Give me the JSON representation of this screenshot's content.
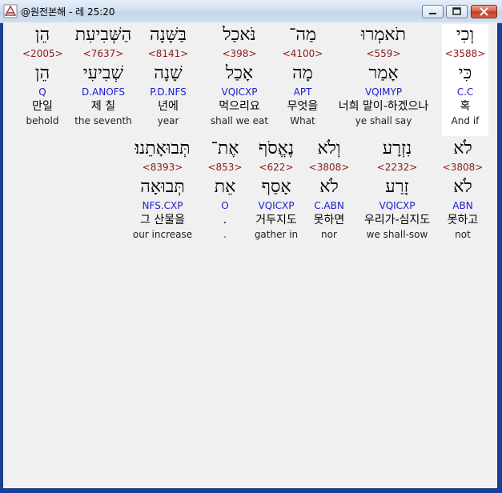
{
  "window": {
    "title": "@원전본해 - 레 25:20"
  },
  "rows": [
    {
      "words": [
        {
          "heb": "וְכִי",
          "strong": "<3588>",
          "lemma": "כִּי",
          "parse": "C.C",
          "kor": "혹",
          "eng": "And if",
          "selected": true
        },
        {
          "heb": "תֹאמְרוּ",
          "strong": "<559>",
          "lemma": "אָמַר",
          "parse": "VQIMYP",
          "kor": "너희 말이-하겠으나",
          "eng": "ye shall say",
          "selected": false
        },
        {
          "heb": "מַה־",
          "strong": "<4100>",
          "lemma": "מָה",
          "parse": "APT",
          "kor": "무엇을",
          "eng": "What",
          "selected": false
        },
        {
          "heb": "נֹּאכַל",
          "strong": "<398>",
          "lemma": "אָכַל",
          "parse": "VQICXP",
          "kor": "먹으리요",
          "eng": "shall we eat",
          "selected": false
        },
        {
          "heb": "בַּשָּׁנָה",
          "strong": "<8141>",
          "lemma": "שָׁנָה",
          "parse": "P.D.NFS",
          "kor": "년에",
          "eng": "year",
          "selected": false
        },
        {
          "heb": "הַשְּׁבִיעִת",
          "strong": "<7637>",
          "lemma": "שְׁבִיעִי",
          "parse": "D.ANOFS",
          "kor": "제 칠",
          "eng": "the seventh",
          "selected": false
        },
        {
          "heb": "הֵן",
          "strong": "<2005>",
          "lemma": "הֵן",
          "parse": "Q",
          "kor": "만일",
          "eng": "behold",
          "selected": false
        }
      ]
    },
    {
      "words": [
        {
          "heb": "לֹא",
          "strong": "<3808>",
          "lemma": "לֹא",
          "parse": "ABN",
          "kor": "못하고",
          "eng": "not",
          "selected": false
        },
        {
          "heb": "נִזְרָע",
          "strong": "<2232>",
          "lemma": "זָרַע",
          "parse": "VQICXP",
          "kor": "우리가-심지도",
          "eng": "we shall-sow",
          "selected": false
        },
        {
          "heb": "וְלֹא",
          "strong": "<3808>",
          "lemma": "לֹא",
          "parse": "C.ABN",
          "kor": "못하면",
          "eng": "nor",
          "selected": false
        },
        {
          "heb": "נֶאֱסֹף",
          "strong": "<622>",
          "lemma": "אָסַף",
          "parse": "VQICXP",
          "kor": "거두지도",
          "eng": "gather in",
          "selected": false
        },
        {
          "heb": "אֶת־",
          "strong": "<853>",
          "lemma": "אֵת",
          "parse": "O",
          "kor": ".",
          "eng": ".",
          "selected": false
        },
        {
          "heb": "תְּבוּאָתֵנוּ׃",
          "strong": "<8393>",
          "lemma": "תְּבוּאָה",
          "parse": "NFS.CXP",
          "kor": "그 산물을",
          "eng": "our increase",
          "selected": false
        }
      ]
    }
  ]
}
